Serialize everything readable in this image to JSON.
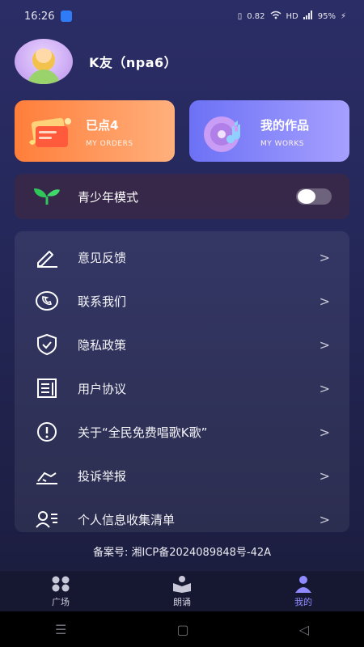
{
  "status": {
    "time": "16:26",
    "net_speed": "0.82",
    "network": "HD",
    "battery": "95%"
  },
  "profile": {
    "username": "K友（npa6）"
  },
  "cards": {
    "orders": {
      "title": "已点4",
      "subtitle": "MY ORDERS"
    },
    "works": {
      "title": "我的作品",
      "subtitle": "MY WORKS"
    }
  },
  "youth": {
    "label": "青少年模式",
    "enabled": false
  },
  "menu": {
    "items": [
      {
        "label": "意见反馈",
        "icon": "feedback-edit-icon"
      },
      {
        "label": "联系我们",
        "icon": "phone-icon"
      },
      {
        "label": "隐私政策",
        "icon": "shield-check-icon"
      },
      {
        "label": "用户协议",
        "icon": "document-icon"
      },
      {
        "label": "关于“全民免费唱歌K歌”",
        "icon": "info-icon"
      },
      {
        "label": "投诉举报",
        "icon": "report-icon"
      },
      {
        "label": "个人信息收集清单",
        "icon": "user-list-icon"
      }
    ],
    "chevron": ">"
  },
  "icp": "备案号: 湘ICP备2024089848号-42A",
  "tabbar": {
    "tabs": [
      {
        "label": "广场",
        "icon": "grid-icon",
        "active": false
      },
      {
        "label": "朗诵",
        "icon": "book-reader-icon",
        "active": false
      },
      {
        "label": "我的",
        "icon": "person-icon",
        "active": true
      }
    ]
  },
  "colors": {
    "accent": "#8f8bff",
    "orders_card": "#ff8a45",
    "works_card": "#7f7cf7",
    "youth_leaf": "#2fc65a"
  }
}
